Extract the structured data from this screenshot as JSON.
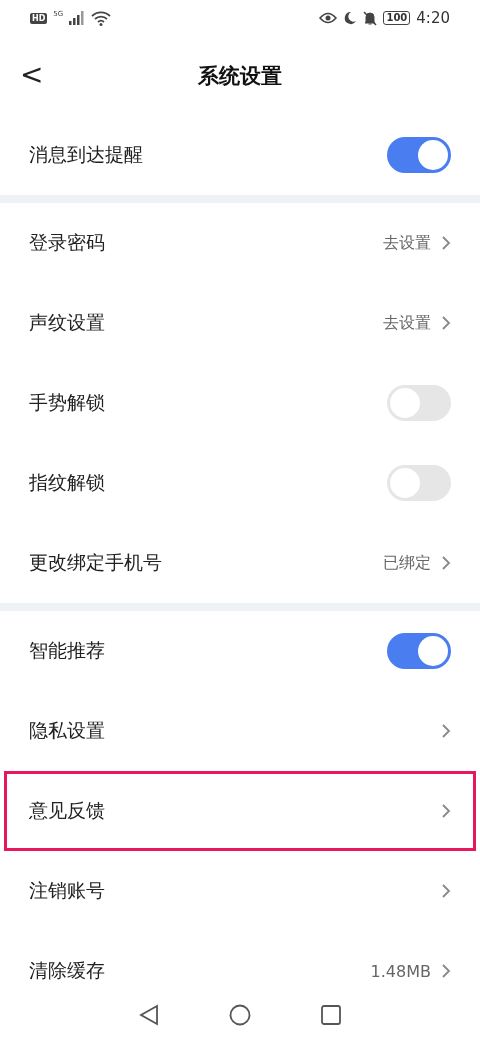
{
  "status_bar": {
    "hd": "HD",
    "network": "5G",
    "battery": "100",
    "time": "4:20"
  },
  "header": {
    "back": "<",
    "title": "系统设置"
  },
  "sections": [
    {
      "rows": [
        {
          "kind": "toggle",
          "label": "消息到达提醒",
          "on": true
        }
      ]
    },
    {
      "rows": [
        {
          "kind": "link",
          "label": "登录密码",
          "value": "去设置"
        },
        {
          "kind": "link",
          "label": "声纹设置",
          "value": "去设置"
        },
        {
          "kind": "toggle",
          "label": "手势解锁",
          "on": false
        },
        {
          "kind": "toggle",
          "label": "指纹解锁",
          "on": false
        },
        {
          "kind": "link",
          "label": "更改绑定手机号",
          "value": "已绑定"
        }
      ]
    },
    {
      "rows": [
        {
          "kind": "toggle",
          "label": "智能推荐",
          "on": true
        },
        {
          "kind": "link",
          "label": "隐私设置"
        },
        {
          "kind": "link",
          "label": "意见反馈",
          "highlighted": true
        },
        {
          "kind": "link",
          "label": "注销账号"
        },
        {
          "kind": "link",
          "label": "清除缓存",
          "value": "1.48MB"
        }
      ]
    }
  ]
}
